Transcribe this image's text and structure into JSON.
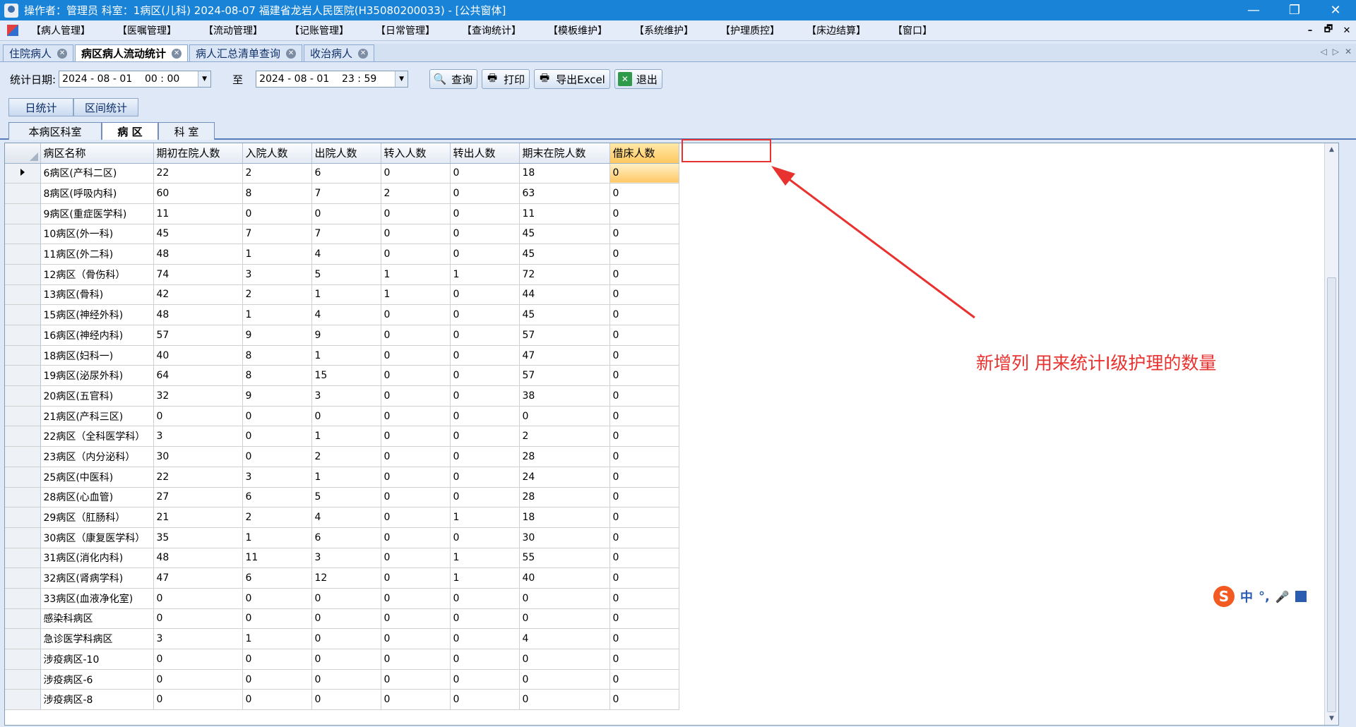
{
  "titlebar": {
    "title": "操作者：管理员  科室：1病区(儿科)  2024-08-07  福建省龙岩人民医院(H35080200033) - [公共窗体]",
    "min": "—",
    "max": "❐",
    "close": "✕"
  },
  "menu": [
    "【病人管理】",
    "【医嘱管理】",
    "【流动管理】",
    "【记账管理】",
    "【日常管理】",
    "【查询统计】",
    "【模板维护】",
    "【系统维护】",
    "【护理质控】",
    "【床边结算】",
    "【窗口】"
  ],
  "mdi": {
    "min": "–",
    "restore": "🗗",
    "close": "✕"
  },
  "doc_tabs": [
    {
      "label": "住院病人",
      "active": false
    },
    {
      "label": "病区病人流动统计",
      "active": true
    },
    {
      "label": "病人汇总清单查询",
      "active": false
    },
    {
      "label": "收治病人",
      "active": false
    }
  ],
  "tab_nav": {
    "prev": "◁",
    "next": "▷",
    "close": "✕"
  },
  "filter": {
    "date_label": "统计日期:",
    "start": "2024 - 08 - 01    00 : 00",
    "to": "至",
    "end": "2024 - 08 - 01    23 : 59",
    "buttons": [
      {
        "label": "查询",
        "icon": "search-icon"
      },
      {
        "label": "打印",
        "icon": "printer-icon"
      },
      {
        "label": "导出Excel",
        "icon": "export-excel-icon"
      },
      {
        "label": "退出",
        "icon": "exit-icon"
      }
    ]
  },
  "stat_tabs": [
    "日统计",
    "区间统计"
  ],
  "level_tabs": [
    "本病区科室",
    "病 区",
    "科 室"
  ],
  "table": {
    "columns": [
      "病区名称",
      "期初在院人数",
      "入院人数",
      "出院人数",
      "转入人数",
      "转出人数",
      "期末在院人数",
      "借床人数"
    ],
    "rows": [
      [
        "6病区(产科二区)",
        "22",
        "2",
        "6",
        "0",
        "0",
        "18",
        "0"
      ],
      [
        "8病区(呼吸内科)",
        "60",
        "8",
        "7",
        "2",
        "0",
        "63",
        "0"
      ],
      [
        "9病区(重症医学科)",
        "11",
        "0",
        "0",
        "0",
        "0",
        "11",
        "0"
      ],
      [
        "10病区(外一科)",
        "45",
        "7",
        "7",
        "0",
        "0",
        "45",
        "0"
      ],
      [
        "11病区(外二科)",
        "48",
        "1",
        "4",
        "0",
        "0",
        "45",
        "0"
      ],
      [
        "12病区（骨伤科）",
        "74",
        "3",
        "5",
        "1",
        "1",
        "72",
        "0"
      ],
      [
        "13病区(骨科)",
        "42",
        "2",
        "1",
        "1",
        "0",
        "44",
        "0"
      ],
      [
        "15病区(神经外科)",
        "48",
        "1",
        "4",
        "0",
        "0",
        "45",
        "0"
      ],
      [
        "16病区(神经内科)",
        "57",
        "9",
        "9",
        "0",
        "0",
        "57",
        "0"
      ],
      [
        "18病区(妇科一)",
        "40",
        "8",
        "1",
        "0",
        "0",
        "47",
        "0"
      ],
      [
        "19病区(泌尿外科)",
        "64",
        "8",
        "15",
        "0",
        "0",
        "57",
        "0"
      ],
      [
        "20病区(五官科)",
        "32",
        "9",
        "3",
        "0",
        "0",
        "38",
        "0"
      ],
      [
        "21病区(产科三区)",
        "0",
        "0",
        "0",
        "0",
        "0",
        "0",
        "0"
      ],
      [
        "22病区（全科医学科）",
        "3",
        "0",
        "1",
        "0",
        "0",
        "2",
        "0"
      ],
      [
        "23病区（内分泌科）",
        "30",
        "0",
        "2",
        "0",
        "0",
        "28",
        "0"
      ],
      [
        "25病区(中医科)",
        "22",
        "3",
        "1",
        "0",
        "0",
        "24",
        "0"
      ],
      [
        "28病区(心血管)",
        "27",
        "6",
        "5",
        "0",
        "0",
        "28",
        "0"
      ],
      [
        "29病区（肛肠科）",
        "21",
        "2",
        "4",
        "0",
        "1",
        "18",
        "0"
      ],
      [
        "30病区（康复医学科）",
        "35",
        "1",
        "6",
        "0",
        "0",
        "30",
        "0"
      ],
      [
        "31病区(消化内科)",
        "48",
        "11",
        "3",
        "0",
        "1",
        "55",
        "0"
      ],
      [
        "32病区(肾病学科)",
        "47",
        "6",
        "12",
        "0",
        "1",
        "40",
        "0"
      ],
      [
        "33病区(血液净化室)",
        "0",
        "0",
        "0",
        "0",
        "0",
        "0",
        "0"
      ],
      [
        "感染科病区",
        "0",
        "0",
        "0",
        "0",
        "0",
        "0",
        "0"
      ],
      [
        "急诊医学科病区",
        "3",
        "1",
        "0",
        "0",
        "0",
        "4",
        "0"
      ],
      [
        "涉疫病区-10",
        "0",
        "0",
        "0",
        "0",
        "0",
        "0",
        "0"
      ],
      [
        "涉疫病区-6",
        "0",
        "0",
        "0",
        "0",
        "0",
        "0",
        "0"
      ],
      [
        "涉疫病区-8",
        "0",
        "0",
        "0",
        "0",
        "0",
        "0",
        "0"
      ]
    ]
  },
  "annotation": {
    "text": "新增列 用来统计I级护理的数量",
    "color": "#e8322f"
  },
  "ime": {
    "logo": "S",
    "lang": "中",
    "punct": "°,",
    "mic": "🎤"
  },
  "colors": {
    "titlebar": "#1883d7",
    "header_highlight": "#ffc860",
    "annotation": "#e8322f"
  }
}
